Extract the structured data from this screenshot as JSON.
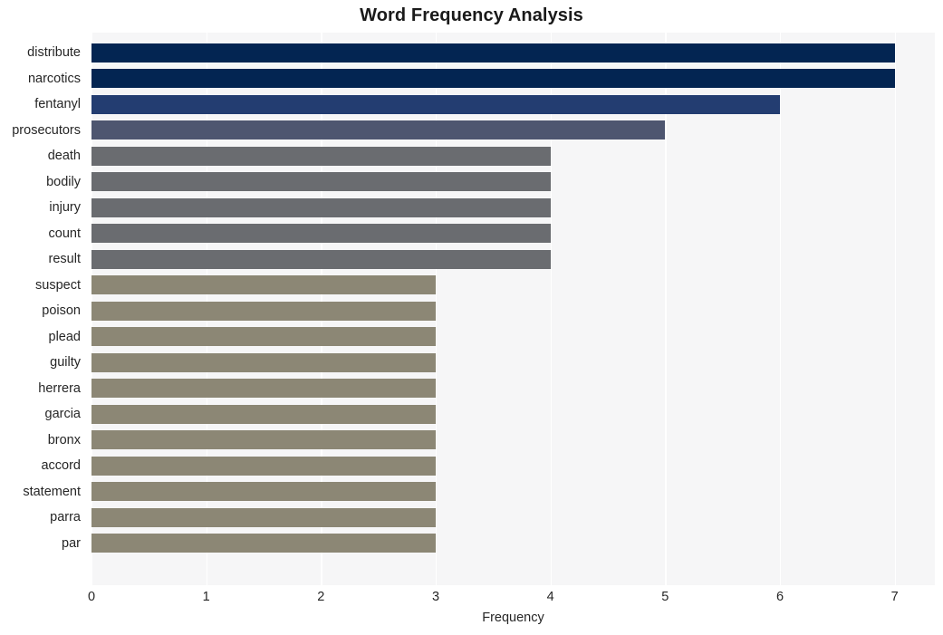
{
  "chart_data": {
    "type": "bar",
    "orientation": "horizontal",
    "title": "Word Frequency Analysis",
    "xlabel": "Frequency",
    "ylabel": "",
    "categories": [
      "distribute",
      "narcotics",
      "fentanyl",
      "prosecutors",
      "death",
      "bodily",
      "injury",
      "count",
      "result",
      "suspect",
      "poison",
      "plead",
      "guilty",
      "herrera",
      "garcia",
      "bronx",
      "accord",
      "statement",
      "parra",
      "par"
    ],
    "values": [
      7,
      7,
      6,
      5,
      4,
      4,
      4,
      4,
      4,
      3,
      3,
      3,
      3,
      3,
      3,
      3,
      3,
      3,
      3,
      3
    ],
    "bar_colors": [
      "#032552",
      "#032552",
      "#233d71",
      "#4e5670",
      "#6a6c70",
      "#6a6c70",
      "#6a6c70",
      "#6a6c70",
      "#6a6c70",
      "#8c8775",
      "#8c8775",
      "#8c8775",
      "#8c8775",
      "#8c8775",
      "#8c8775",
      "#8c8775",
      "#8c8775",
      "#8c8775",
      "#8c8775",
      "#8c8775"
    ],
    "xlim": [
      0,
      7.35
    ],
    "xticks": [
      0,
      1,
      2,
      3,
      4,
      5,
      6,
      7
    ],
    "xtick_labels": [
      "0",
      "1",
      "2",
      "3",
      "4",
      "5",
      "6",
      "7"
    ],
    "grid": true,
    "grid_color": "#ffffff",
    "plot_background": "#f6f6f7",
    "figure_background": "#ffffff",
    "legend": null
  }
}
